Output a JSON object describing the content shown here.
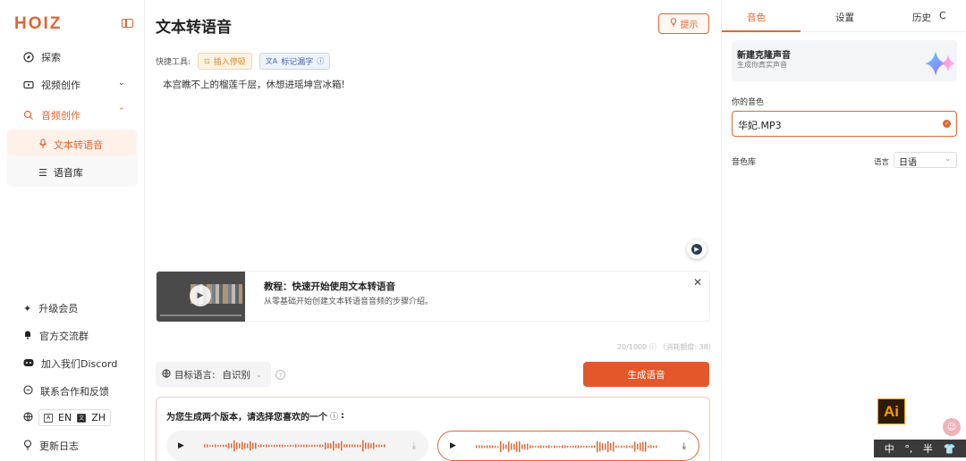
{
  "sidebar": {
    "logo": "HOIZ",
    "nav": {
      "explore": "探索",
      "video": "视频创作",
      "audio": "音频创作",
      "tts": "文本转语音",
      "library": "语音库"
    },
    "bottom": {
      "upgrade": "升级会员",
      "community": "官方交流群",
      "discord": "加入我们Discord",
      "contact": "联系合作和反馈",
      "changelog": "更新日志"
    },
    "lang": {
      "en": "EN",
      "zh": "ZH"
    }
  },
  "main": {
    "title": "文本转语音",
    "hint_label": "提示",
    "tools_label": "快捷工具:",
    "tool_pause": "插入停顿",
    "tool_mark": "标记漏字",
    "editor_text": "本宫瞧不上的榴莲千层，休想进瑶坤宫冰箱!",
    "tutorial": {
      "title": "教程：快速开始使用文本转语音",
      "desc": "从零基础开始创建文本转语音音频的步骤介绍。"
    },
    "counter": "20/1000 ⓘ （消耗额度: 38）",
    "target_lang_label": "目标语言:",
    "target_lang_value": "自识别",
    "generate_label": "生成语音",
    "versions_title": "为您生成两个版本，请选择您喜欢的一个"
  },
  "right": {
    "tabs": {
      "voice": "音色",
      "settings": "设置",
      "history": "历史"
    },
    "clone_title": "新建克隆声音",
    "clone_sub": "生成你真实声音",
    "your_voice_label": "你的音色",
    "your_voice_value": "华妃.MP3",
    "library_label": "音色库",
    "language_label": "语言",
    "language_value": "日语"
  },
  "overlay": {
    "ai_badge": "Ai",
    "ime": [
      "中",
      "°,",
      "半"
    ]
  },
  "colors": {
    "accent": "#e36530",
    "button": "#e4572a"
  }
}
